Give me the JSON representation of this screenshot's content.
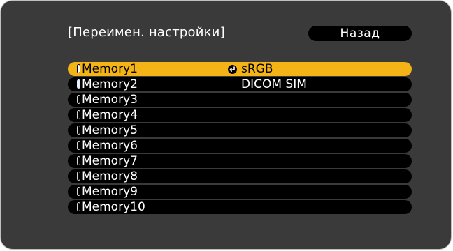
{
  "dialog": {
    "title": "[Переимен. настройки]",
    "back_label": "Назад"
  },
  "memory_list": [
    {
      "label": "Memory1",
      "value": "sRGB",
      "selected": true,
      "level": "active"
    },
    {
      "label": "Memory2",
      "value": "DICOM SIM",
      "selected": false,
      "level": "active"
    },
    {
      "label": "Memory3",
      "value": "",
      "selected": false,
      "level": "inactive"
    },
    {
      "label": "Memory4",
      "value": "",
      "selected": false,
      "level": "inactive"
    },
    {
      "label": "Memory5",
      "value": "",
      "selected": false,
      "level": "inactive"
    },
    {
      "label": "Memory6",
      "value": "",
      "selected": false,
      "level": "inactive"
    },
    {
      "label": "Memory7",
      "value": "",
      "selected": false,
      "level": "inactive"
    },
    {
      "label": "Memory8",
      "value": "",
      "selected": false,
      "level": "inactive"
    },
    {
      "label": "Memory9",
      "value": "",
      "selected": false,
      "level": "inactive"
    },
    {
      "label": "Memory10",
      "value": "",
      "selected": false,
      "level": "inactive"
    }
  ],
  "icons": {
    "enter": "enter-icon",
    "memory_level": "memory-level-icon"
  },
  "colors": {
    "background": "#3a3a3a",
    "item_background": "#000000",
    "selected_background": "#f4b418",
    "text": "#ffffff",
    "selected_text": "#000000"
  }
}
